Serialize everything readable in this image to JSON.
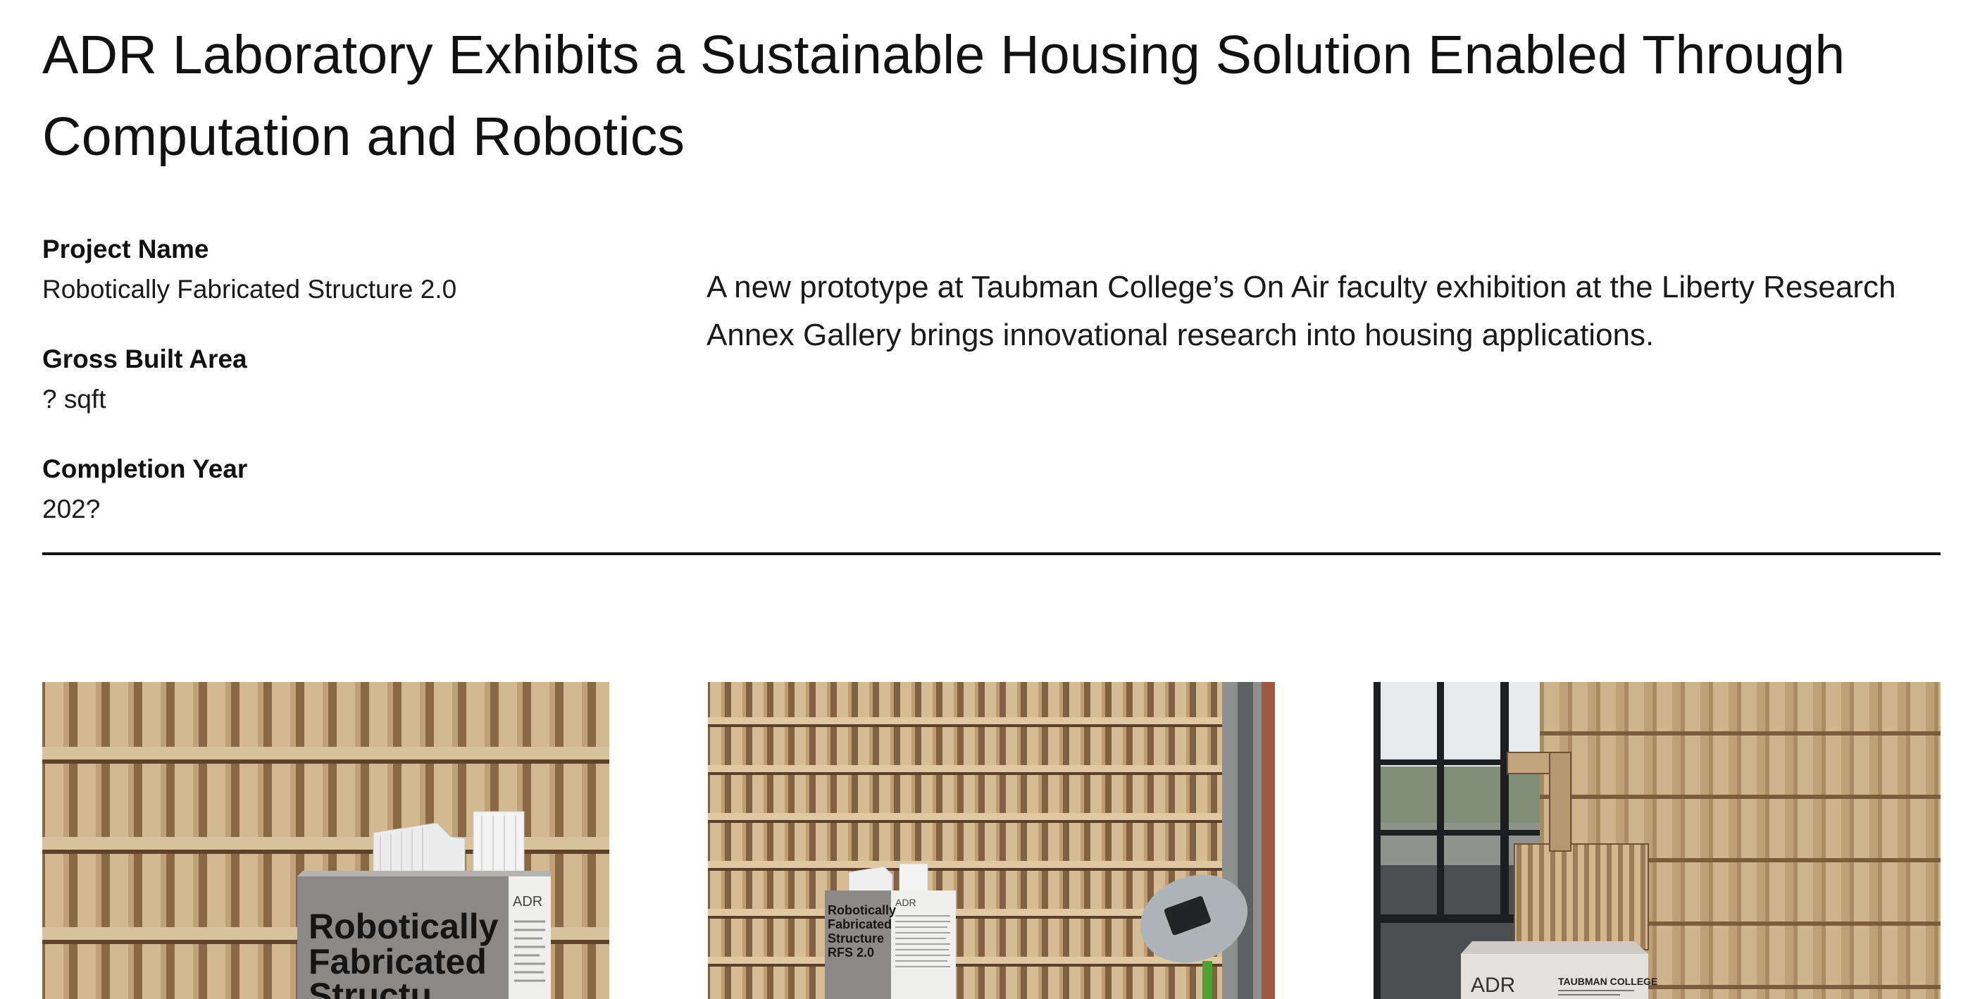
{
  "article": {
    "title": "ADR Laboratory Exhibits a Sustainable Housing Solution Enabled Through Computation and Robotics",
    "summary": "A new prototype at Taubman College’s On Air faculty exhibition at the Liberty Research Annex Gallery brings innovational research into housing applications."
  },
  "project_info": [
    {
      "label": "Project Name",
      "value": "Robotically Fabricated Structure 2.0"
    },
    {
      "label": "Gross Built Area",
      "value": "? sqft"
    },
    {
      "label": "Completion Year",
      "value": "202?"
    }
  ],
  "gallery": {
    "photo1": {
      "sign_lines": [
        "Robotically",
        "Fabricated",
        "Structu"
      ],
      "logo": "ADR"
    },
    "photo2": {
      "sign_lines": [
        "Robotically",
        "Fabricated",
        "Structure",
        "RFS 2.0"
      ],
      "logo": "ADR"
    },
    "photo3": {
      "logo": "ADR",
      "sign_text": "TAUBMAN COLLEGE"
    }
  },
  "colors": {
    "wood_light": "#d8bf96",
    "wood_mid": "#b8976b",
    "wood_dark": "#6e5336",
    "sign_panel": "#8a8886",
    "text": "#111111"
  }
}
